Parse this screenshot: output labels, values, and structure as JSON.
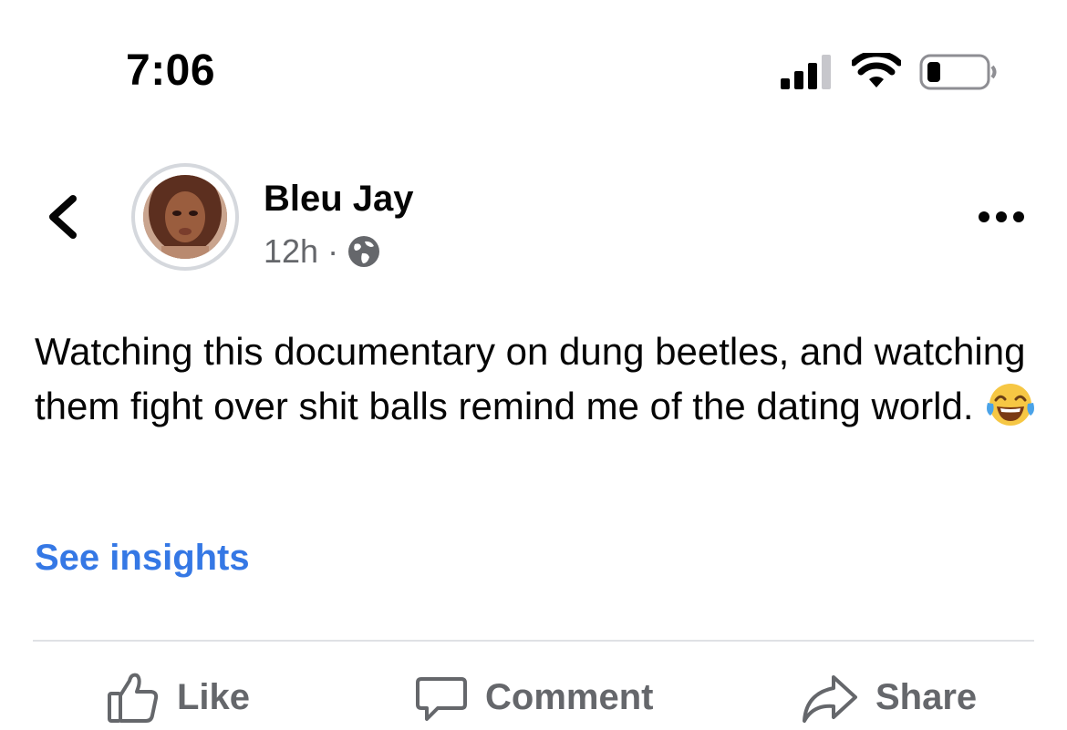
{
  "status_bar": {
    "time": "7:06",
    "icons": [
      "cellular-signal-icon",
      "wifi-icon",
      "battery-icon"
    ]
  },
  "header": {
    "back_icon": "chevron-left-icon",
    "author_name": "Bleu Jay",
    "timestamp": "12h",
    "separator": "·",
    "audience_icon": "globe-icon",
    "more_icon": "more-horizontal-icon"
  },
  "post": {
    "text": "Watching this documentary on dung beetles, and watching them fight over shit balls remind me of the dating world.",
    "emoji": "face-with-tears-of-joy-icon"
  },
  "insights_link": "See insights",
  "actions": {
    "like_label": "Like",
    "comment_label": "Comment",
    "share_label": "Share"
  },
  "colors": {
    "link": "#3578e5",
    "secondary_text": "#65676b",
    "primary_text": "#050505",
    "divider": "#dfe1e5"
  }
}
